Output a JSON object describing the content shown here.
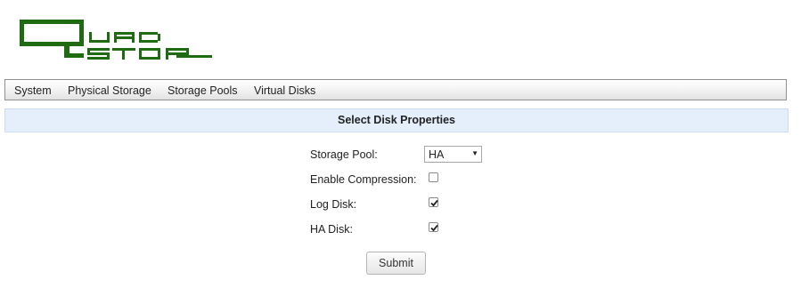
{
  "brand": {
    "logo_text": "QUADSTOR",
    "logo_color": "#1e6b12"
  },
  "nav": {
    "items": [
      {
        "label": "System"
      },
      {
        "label": "Physical Storage"
      },
      {
        "label": "Storage Pools"
      },
      {
        "label": "Virtual Disks"
      }
    ]
  },
  "form": {
    "title": "Select Disk Properties",
    "storage_pool": {
      "label": "Storage Pool:",
      "value": "HA"
    },
    "enable_compression": {
      "label": "Enable Compression:",
      "checked": false
    },
    "log_disk": {
      "label": "Log Disk:",
      "checked": true
    },
    "ha_disk": {
      "label": "HA Disk:",
      "checked": true
    },
    "submit_label": "Submit"
  },
  "colors": {
    "header_bg": "#e5effb",
    "logo_green": "#1e6b12"
  }
}
